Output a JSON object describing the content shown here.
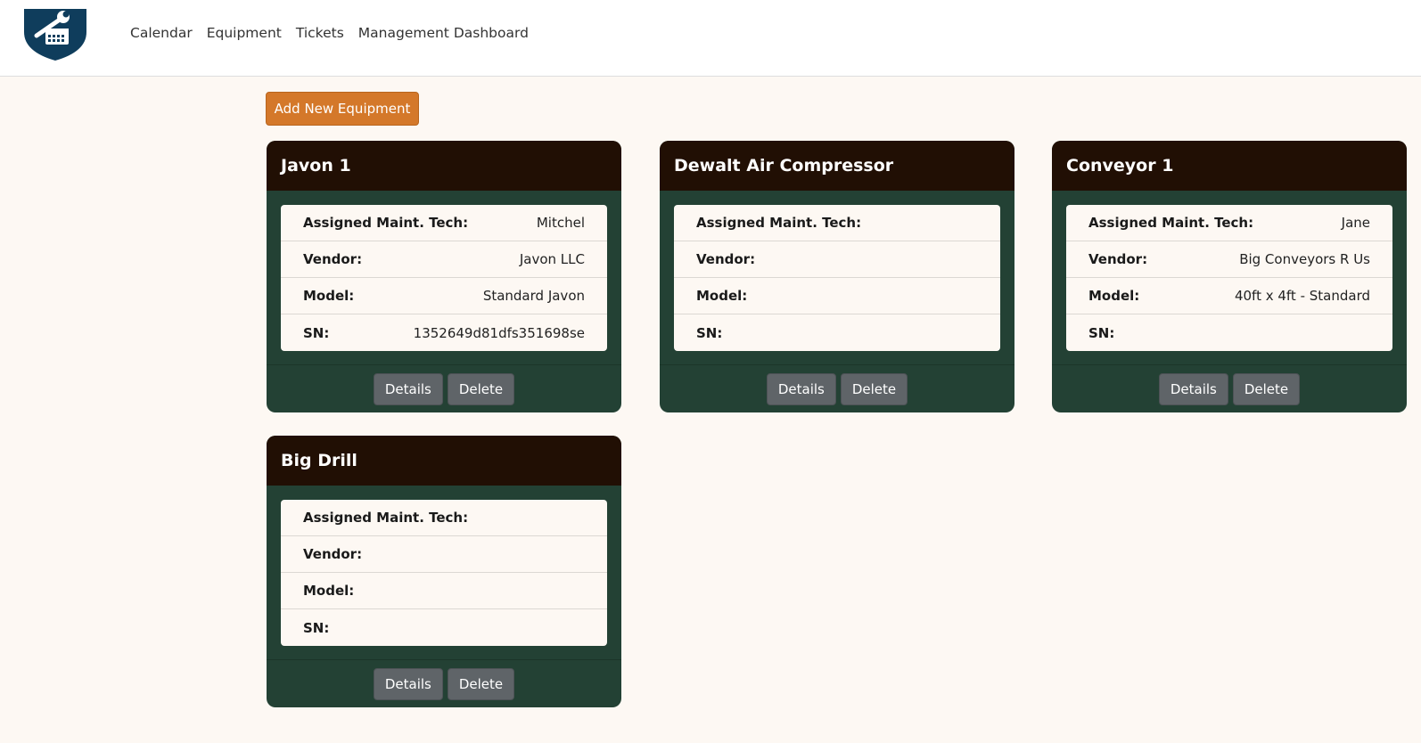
{
  "nav": {
    "links": [
      "Calendar",
      "Equipment",
      "Tickets",
      "Management Dashboard"
    ]
  },
  "actions": {
    "add_label": "Add New Equipment"
  },
  "colors": {
    "accent": "#d4782a",
    "card_header": "#210f04",
    "card_body": "#234134",
    "page_bg": "#fdf8f3"
  },
  "equipment": [
    {
      "name": "Javon 1",
      "fields": [
        {
          "label": "Assigned Maint. Tech:",
          "value": "Mitchel"
        },
        {
          "label": "Vendor:",
          "value": "Javon LLC"
        },
        {
          "label": "Model:",
          "value": "Standard Javon"
        },
        {
          "label": "SN:",
          "value": "1352649d81dfs351698se"
        }
      ],
      "details_label": "Details",
      "delete_label": "Delete"
    },
    {
      "name": "Dewalt Air Compressor",
      "fields": [
        {
          "label": "Assigned Maint. Tech:",
          "value": ""
        },
        {
          "label": "Vendor:",
          "value": ""
        },
        {
          "label": "Model:",
          "value": ""
        },
        {
          "label": "SN:",
          "value": ""
        }
      ],
      "details_label": "Details",
      "delete_label": "Delete"
    },
    {
      "name": "Conveyor 1",
      "fields": [
        {
          "label": "Assigned Maint. Tech:",
          "value": "Jane"
        },
        {
          "label": "Vendor:",
          "value": "Big Conveyors R Us"
        },
        {
          "label": "Model:",
          "value": "40ft x 4ft - Standard"
        },
        {
          "label": "SN:",
          "value": ""
        }
      ],
      "details_label": "Details",
      "delete_label": "Delete"
    },
    {
      "name": "Big Drill",
      "fields": [
        {
          "label": "Assigned Maint. Tech:",
          "value": ""
        },
        {
          "label": "Vendor:",
          "value": ""
        },
        {
          "label": "Model:",
          "value": ""
        },
        {
          "label": "SN:",
          "value": ""
        }
      ],
      "details_label": "Details",
      "delete_label": "Delete"
    }
  ]
}
